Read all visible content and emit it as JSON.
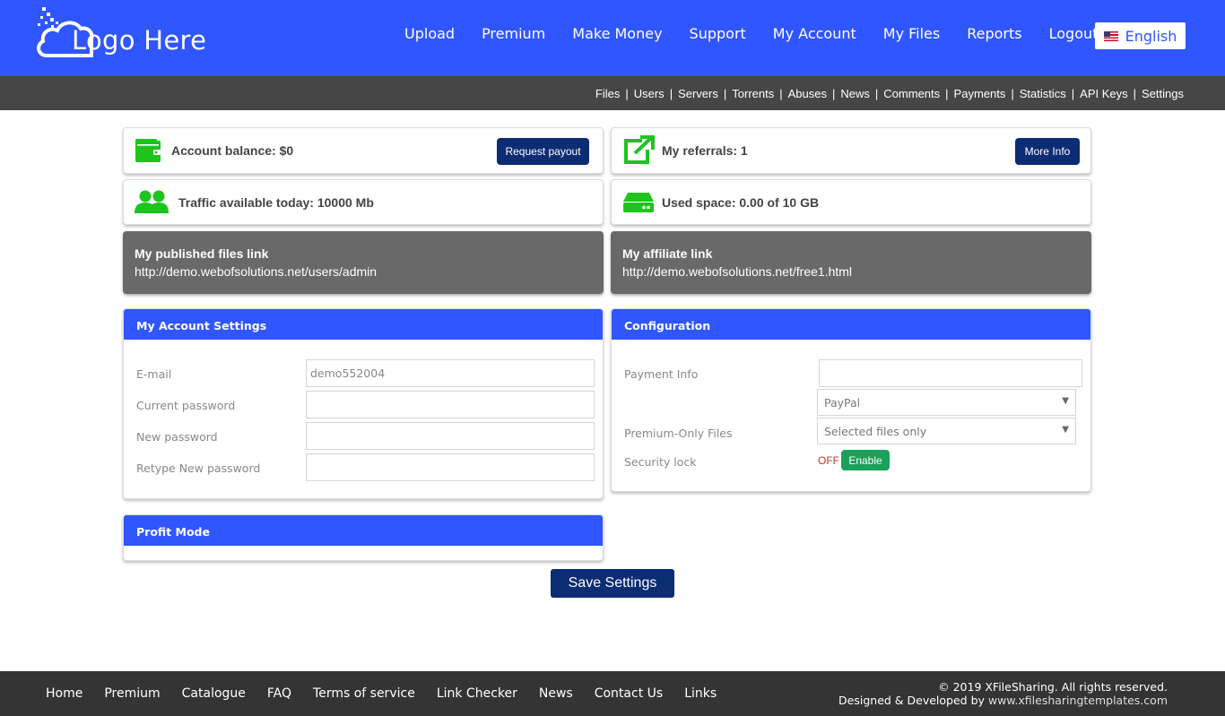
{
  "header": {
    "logo_text": "Logo Here",
    "nav": [
      "Upload",
      "Premium",
      "Make Money",
      "Support",
      "My Account",
      "My Files",
      "Reports",
      "Logout"
    ],
    "language": "English"
  },
  "admin_links": [
    "Files",
    "Users",
    "Servers",
    "Torrents",
    "Abuses",
    "News",
    "Comments",
    "Payments",
    "Statistics",
    "API Keys",
    "Settings"
  ],
  "cards": {
    "balance": {
      "text": "Account balance: $0",
      "button": "Request payout",
      "icon": "wallet-icon"
    },
    "referrals": {
      "text": "My referrals: 1",
      "button": "More Info",
      "icon": "external-link-icon"
    },
    "traffic": {
      "text": "Traffic available today: 10000 Mb",
      "icon": "users-icon"
    },
    "space": {
      "text": "Used space: 0.00 of 10 GB",
      "icon": "hard-drive-icon"
    },
    "published": {
      "title": "My published files link",
      "url": "http://demo.webofsolutions.net/users/admin"
    },
    "affiliate": {
      "title": "My affiliate link",
      "url": "http://demo.webofsolutions.net/free1.html"
    }
  },
  "account_settings": {
    "title": "My Account Settings",
    "email_label": "E-mail",
    "email_value": "demo552004",
    "current_password_label": "Current password",
    "new_password_label": "New password",
    "retype_password_label": "Retype New password"
  },
  "configuration": {
    "title": "Configuration",
    "payment_info_label": "Payment Info",
    "payment_info_value": "",
    "payment_method": "PayPal",
    "premium_only_label": "Premium-Only Files",
    "premium_only_value": "Selected files only",
    "security_lock_label": "Security lock",
    "security_state": "OFF",
    "enable_button": "Enable"
  },
  "profit_mode": {
    "title": "Profit Mode"
  },
  "save_button": "Save Settings",
  "footer": {
    "links": [
      "Home",
      "Premium",
      "Catalogue",
      "FAQ",
      "Terms of service",
      "Link Checker",
      "News",
      "Contact Us",
      "Links"
    ],
    "copyright": "© 2019 XFileSharing. All rights reserved.",
    "designed_by": "Designed & Developed by",
    "designer_url": "www.xfilesharingtemplates.com"
  },
  "colors": {
    "primary": "#2f56ff",
    "navy": "#0c2c74",
    "green": "#1ec41e",
    "dark_bar": "#464646",
    "footer": "#343434"
  }
}
